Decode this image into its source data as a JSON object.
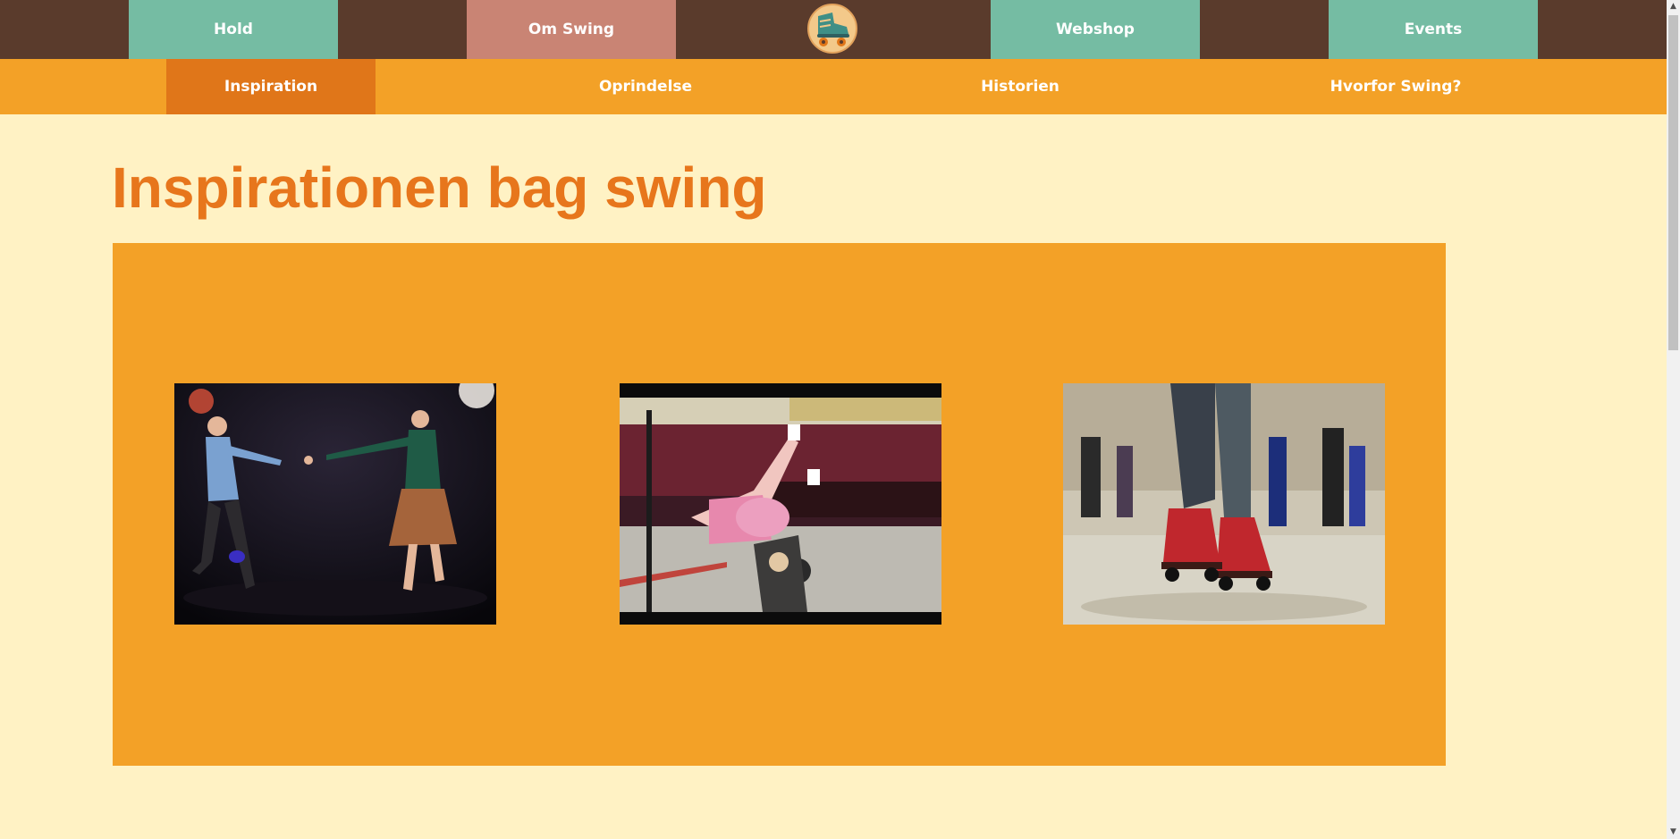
{
  "colors": {
    "topnav_bg": "#5a3b2c",
    "subnav_bg": "#f3a127",
    "teal": "#75bca3",
    "rose": "#c98474",
    "active_sub": "#e07619",
    "title": "#e7761c",
    "page_bg": "#fff2c4"
  },
  "topnav": {
    "items": [
      {
        "label": "Hold"
      },
      {
        "label": "Om Swing"
      },
      {
        "label": "Webshop"
      },
      {
        "label": "Events"
      }
    ],
    "logo_icon": "roller-skate-icon"
  },
  "subnav": {
    "items": [
      {
        "label": "Inspiration"
      },
      {
        "label": "Oprindelse"
      },
      {
        "label": "Historien"
      },
      {
        "label": "Hvorfor Swing?"
      }
    ],
    "active": "Inspiration"
  },
  "main": {
    "title": "Inspirationen bag swing"
  },
  "gallery": {
    "photos": [
      {
        "icon": "swing-dancers-photo"
      },
      {
        "icon": "skate-dance-lift-photo"
      },
      {
        "icon": "roller-skates-photo"
      }
    ]
  }
}
